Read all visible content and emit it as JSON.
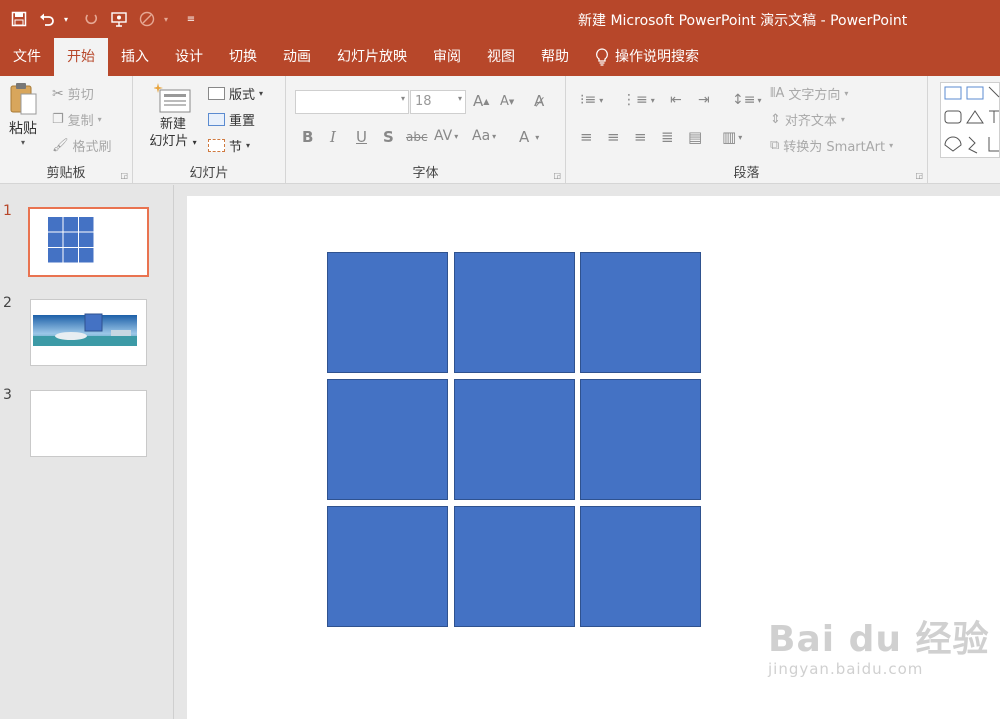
{
  "app": {
    "title": "新建 Microsoft PowerPoint 演示文稿 - PowerPoint"
  },
  "quick_access": {
    "icons": [
      "save-icon",
      "undo-icon",
      "redo-icon",
      "present-icon",
      "touch-mode-icon",
      "customize-icon"
    ]
  },
  "tabs": [
    {
      "label": "文件"
    },
    {
      "label": "开始"
    },
    {
      "label": "插入"
    },
    {
      "label": "设计"
    },
    {
      "label": "切换"
    },
    {
      "label": "动画"
    },
    {
      "label": "幻灯片放映"
    },
    {
      "label": "审阅"
    },
    {
      "label": "视图"
    },
    {
      "label": "帮助"
    },
    {
      "label": "操作说明搜索"
    }
  ],
  "active_tab": "开始",
  "ribbon": {
    "clipboard": {
      "label": "剪贴板",
      "paste": "粘贴",
      "cut": "剪切",
      "copy": "复制",
      "format_painter": "格式刷"
    },
    "slides": {
      "label": "幻灯片",
      "new_slide_line1": "新建",
      "new_slide_line2": "幻灯片",
      "layout": "版式",
      "reset": "重置",
      "section": "节"
    },
    "font": {
      "label": "字体",
      "font_name": "",
      "font_size": "18",
      "bold": "B",
      "italic": "I",
      "underline": "U",
      "shadow": "S",
      "strike": "abc",
      "spacing": "AV",
      "case": "Aa",
      "color": "A",
      "grow": "A",
      "shrink": "A"
    },
    "paragraph": {
      "label": "段落",
      "text_direction": "文字方向",
      "align_text": "对齐文本",
      "smartart": "转换为 SmartArt"
    }
  },
  "slides_panel": [
    {
      "number": "1"
    },
    {
      "number": "2"
    },
    {
      "number": "3"
    }
  ],
  "selected_slide": "1",
  "slide": {
    "grid_rows": 3,
    "grid_cols": 3,
    "shape_color": "#4472c4"
  },
  "watermark": {
    "line1": "Bai du 经验",
    "line2": "jingyan.baidu.com"
  },
  "colors": {
    "accent": "#b7472a",
    "selection": "#e97350"
  }
}
